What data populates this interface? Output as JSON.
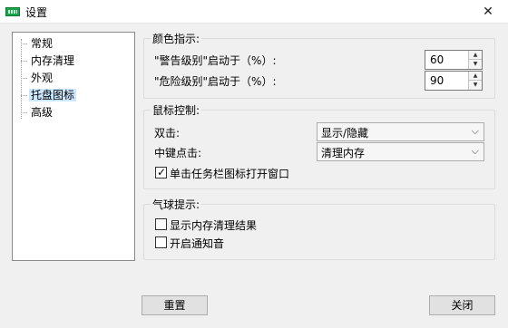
{
  "window": {
    "title": "设置",
    "close_glyph": "✕",
    "app_icon": "battery-app-icon"
  },
  "tree": {
    "items": [
      {
        "label": "常规",
        "selected": false
      },
      {
        "label": "内存清理",
        "selected": false
      },
      {
        "label": "外观",
        "selected": false
      },
      {
        "label": "托盘图标",
        "selected": true
      },
      {
        "label": "高级",
        "selected": false
      }
    ]
  },
  "color_group": {
    "title": "颜色指示:",
    "warning_label": "\"警告级别\"启动于（%）:",
    "warning_value": "60",
    "danger_label": "\"危险级别\"启动于（%）:",
    "danger_value": "90"
  },
  "mouse_group": {
    "title": "鼠标控制:",
    "double_click_label": "双击:",
    "double_click_value": "显示/隐藏",
    "middle_click_label": "中键点击:",
    "middle_click_value": "清理内存",
    "taskbar_check_label": "单击任务栏图标打开窗口",
    "taskbar_checked": true
  },
  "balloon_group": {
    "title": "气球提示:",
    "show_result_label": "显示内存清理结果",
    "show_result_checked": false,
    "sound_label": "开启通知音",
    "sound_checked": false
  },
  "buttons": {
    "reset": "重置",
    "close": "关闭"
  },
  "glyphs": {
    "check": "✓",
    "spin_up": "▲",
    "spin_down": "▼",
    "chevron": "⌵"
  }
}
